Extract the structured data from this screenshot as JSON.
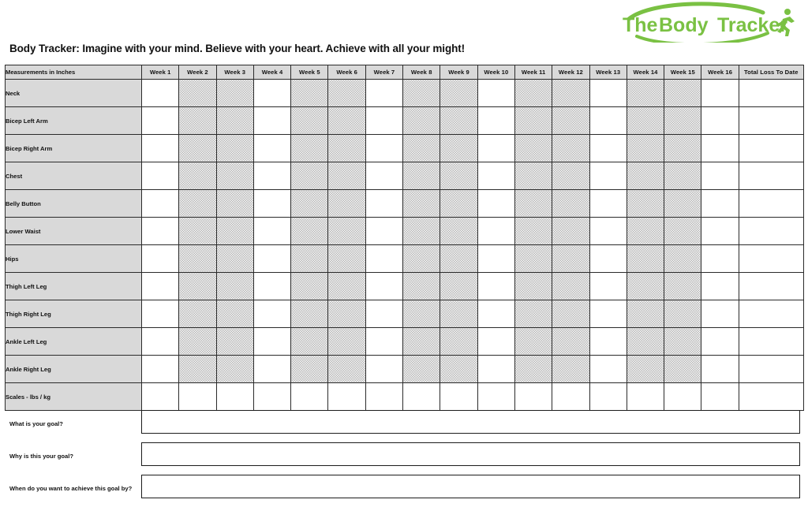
{
  "brand": {
    "logo_text_the": "The",
    "logo_text_body": "Body",
    "logo_text_tracker": "Tracker",
    "logo_color": "#7ac143",
    "runner_icon": "running-figure-icon"
  },
  "page_title": "Body Tracker: Imagine with your mind. Believe with your heart. Achieve with all your might!",
  "table": {
    "row_header_label": "Measurements in Inches",
    "week_columns": [
      "Week 1",
      "Week 2",
      "Week 3",
      "Week 4",
      "Week 5",
      "Week 6",
      "Week 7",
      "Week 8",
      "Week 9",
      "Week 10",
      "Week 11",
      "Week 12",
      "Week 13",
      "Week 14",
      "Week 15",
      "Week 16"
    ],
    "total_column": "Total Loss To Date",
    "shaded_week_indices": [
      1,
      2,
      4,
      5,
      7,
      8,
      10,
      11,
      13,
      14
    ],
    "rows": [
      {
        "label": "Neck",
        "values": [
          "",
          "",
          "",
          "",
          "",
          "",
          "",
          "",
          "",
          "",
          "",
          "",
          "",
          "",
          "",
          ""
        ],
        "total": "",
        "shaded": true
      },
      {
        "label": "Bicep Left Arm",
        "values": [
          "",
          "",
          "",
          "",
          "",
          "",
          "",
          "",
          "",
          "",
          "",
          "",
          "",
          "",
          "",
          ""
        ],
        "total": "",
        "shaded": true
      },
      {
        "label": "Bicep Right Arm",
        "values": [
          "",
          "",
          "",
          "",
          "",
          "",
          "",
          "",
          "",
          "",
          "",
          "",
          "",
          "",
          "",
          ""
        ],
        "total": "",
        "shaded": true
      },
      {
        "label": "Chest",
        "values": [
          "",
          "",
          "",
          "",
          "",
          "",
          "",
          "",
          "",
          "",
          "",
          "",
          "",
          "",
          "",
          ""
        ],
        "total": "",
        "shaded": true
      },
      {
        "label": "Belly Button",
        "values": [
          "",
          "",
          "",
          "",
          "",
          "",
          "",
          "",
          "",
          "",
          "",
          "",
          "",
          "",
          "",
          ""
        ],
        "total": "",
        "shaded": true
      },
      {
        "label": "Lower Waist",
        "values": [
          "",
          "",
          "",
          "",
          "",
          "",
          "",
          "",
          "",
          "",
          "",
          "",
          "",
          "",
          "",
          ""
        ],
        "total": "",
        "shaded": true
      },
      {
        "label": "Hips",
        "values": [
          "",
          "",
          "",
          "",
          "",
          "",
          "",
          "",
          "",
          "",
          "",
          "",
          "",
          "",
          "",
          ""
        ],
        "total": "",
        "shaded": true
      },
      {
        "label": "Thigh Left Leg",
        "values": [
          "",
          "",
          "",
          "",
          "",
          "",
          "",
          "",
          "",
          "",
          "",
          "",
          "",
          "",
          "",
          ""
        ],
        "total": "",
        "shaded": true
      },
      {
        "label": "Thigh Right Leg",
        "values": [
          "",
          "",
          "",
          "",
          "",
          "",
          "",
          "",
          "",
          "",
          "",
          "",
          "",
          "",
          "",
          ""
        ],
        "total": "",
        "shaded": true
      },
      {
        "label": "Ankle Left Leg",
        "values": [
          "",
          "",
          "",
          "",
          "",
          "",
          "",
          "",
          "",
          "",
          "",
          "",
          "",
          "",
          "",
          ""
        ],
        "total": "",
        "shaded": true
      },
      {
        "label": "Ankle Right Leg",
        "values": [
          "",
          "",
          "",
          "",
          "",
          "",
          "",
          "",
          "",
          "",
          "",
          "",
          "",
          "",
          "",
          ""
        ],
        "total": "",
        "shaded": true
      },
      {
        "label": "Scales - lbs / kg",
        "values": [
          "",
          "",
          "",
          "",
          "",
          "",
          "",
          "",
          "",
          "",
          "",
          "",
          "",
          "",
          "",
          ""
        ],
        "total": "",
        "shaded": false
      }
    ]
  },
  "goals": [
    {
      "label": "What is your goal?",
      "value": "",
      "placeholder": ""
    },
    {
      "label": "Why is this your goal?",
      "value": "",
      "placeholder": ""
    },
    {
      "label": "When do you want to achieve this goal by?",
      "value": "",
      "placeholder": ""
    }
  ]
}
